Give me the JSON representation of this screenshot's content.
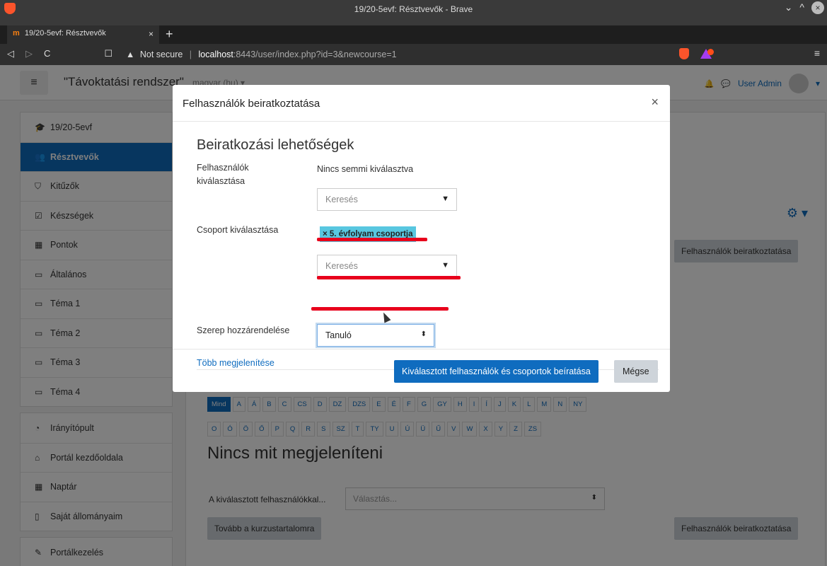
{
  "browser": {
    "window_title": "19/20-5evf: Résztvevők - Brave",
    "tab_title": "19/20-5evf: Résztvevők",
    "tab_favicon": "m",
    "tab_close": "×",
    "new_tab": "+",
    "security_label": "Not secure",
    "url_host": "localhost",
    "url_rest": ":8443/user/index.php?id=3&newcourse=1",
    "nav_back": "◁",
    "nav_forward": "▷",
    "nav_reload": "C",
    "bookmark": "☐",
    "menu": "≡",
    "win_min": "⌄",
    "win_max": "^",
    "win_close": "×"
  },
  "navbar": {
    "hamburger": "≡",
    "site_name": "\"Távoktatási rendszer\"",
    "language": "magyar (hu) ▾",
    "bell": "🔔",
    "chat": "💬",
    "user_name": "User Admin",
    "user_caret": "▾"
  },
  "sidebar": {
    "group1": [
      {
        "icon": "🎓",
        "label": "19/20-5evf"
      },
      {
        "icon": "👥",
        "label": "Résztvevők",
        "active": true
      },
      {
        "icon": "⛉",
        "label": "Kitűzők"
      },
      {
        "icon": "☑",
        "label": "Készségek"
      },
      {
        "icon": "▦",
        "label": "Pontok"
      },
      {
        "icon": "▭",
        "label": "Általános"
      },
      {
        "icon": "▭",
        "label": "Téma 1"
      },
      {
        "icon": "▭",
        "label": "Téma 2"
      },
      {
        "icon": "▭",
        "label": "Téma 3"
      },
      {
        "icon": "▭",
        "label": "Téma 4"
      }
    ],
    "group2": [
      {
        "icon": "◔",
        "label": "Irányítópult"
      },
      {
        "icon": "⌂",
        "label": "Portál kezdőoldala"
      },
      {
        "icon": "▦",
        "label": "Naptár"
      },
      {
        "icon": "▯",
        "label": "Saját állományaim"
      }
    ],
    "group3": [
      {
        "icon": "✎",
        "label": "Portálkezelés"
      }
    ]
  },
  "main": {
    "gear": "⚙ ▾",
    "enrol_button": "Felhasználók beiratkoztatása",
    "letters_row1": [
      "Mind",
      "A",
      "Á",
      "B",
      "C",
      "CS",
      "D",
      "DZ",
      "DZS",
      "E",
      "É",
      "F",
      "G",
      "GY",
      "H",
      "I",
      "Í",
      "J",
      "K",
      "L",
      "M",
      "N",
      "NY"
    ],
    "letters_row2": [
      "O",
      "Ó",
      "Ö",
      "Ő",
      "P",
      "Q",
      "R",
      "S",
      "SZ",
      "T",
      "TY",
      "U",
      "Ú",
      "Ü",
      "Ű",
      "V",
      "W",
      "X",
      "Y",
      "Z",
      "ZS"
    ],
    "nothing_text": "Nincs mit megjeleníteni",
    "with_selected_label": "A kiválasztott felhasználókkal...",
    "with_selected_placeholder": "Választás...",
    "select_caret": "⬍",
    "continue_button": "Tovább a kurzustartalomra",
    "enrol_button_bottom": "Felhasználók beiratkoztatása"
  },
  "modal": {
    "title": "Felhasználók beiratkoztatása",
    "close": "×",
    "section_title": "Beiratkozási lehetőségek",
    "users_label": "Felhasználók kiválasztása",
    "users_value": "Nincs semmi kiválasztva",
    "search_placeholder": "Keresés",
    "dropdown_caret": "▼",
    "cohort_label": "Csoport kiválasztása",
    "cohort_chip": "× 5. évfolyam csoportja",
    "role_label": "Szerep hozzárendelése",
    "role_value": "Tanuló",
    "role_caret": "⬍",
    "more_link": "Több megjelenítése",
    "primary_button": "Kiválasztott felhasználók és csoportok beíratása",
    "cancel_button": "Mégse"
  },
  "annotation_color": "#e8001c"
}
